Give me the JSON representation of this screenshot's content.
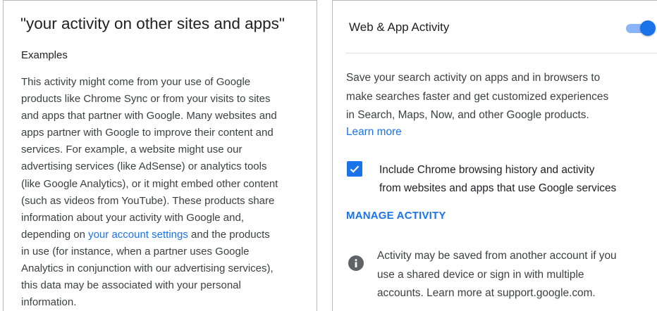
{
  "left": {
    "title": "\"your activity on other sites and apps\"",
    "examples_heading": "Examples",
    "body_lines": [
      "This activity might come from your use of Google",
      "products like Chrome Sync or from your visits to sites",
      "and apps that partner with Google. Many websites and",
      "apps partner with Google to improve their content and",
      "services. For example, a website might use our",
      "advertising services (like AdSense) or analytics tools",
      "(like Google Analytics), or it might embed other content",
      "(such as videos from YouTube). These products share",
      "information about your activity with Google and,"
    ],
    "line10_before": "depending on ",
    "account_settings_link": "your account settings",
    "line10_after": " and the products",
    "body_lines_end": [
      "in use (for instance, when a partner uses Google",
      "Analytics in conjunction with our advertising services),",
      "this data may be associated with your personal",
      "information."
    ]
  },
  "right": {
    "title": "Web & App Activity",
    "toggle_on": true,
    "desc_lines": [
      "Save your search activity on apps and in browsers to",
      "make searches faster and get customized experiences",
      "in Search, Maps, Now, and other Google products."
    ],
    "learn_more": "Learn more",
    "checkbox_checked": true,
    "checkbox_lines": [
      "Include Chrome browsing history and activity",
      "from websites and apps that use Google services"
    ],
    "manage_activity": "MANAGE ACTIVITY",
    "info_lines": [
      "Activity may be saved from another account if you",
      "use a shared device or sign in with multiple",
      "accounts. Learn more at support.google.com."
    ]
  },
  "colors": {
    "accent": "#1a73e8",
    "toggle_track": "#8ab4f8",
    "info_icon": "#5f6368",
    "border": "#b9b9b9"
  },
  "icons": {
    "toggle": "toggle-switch",
    "checkbox": "checkmark-icon",
    "info": "info-icon"
  }
}
